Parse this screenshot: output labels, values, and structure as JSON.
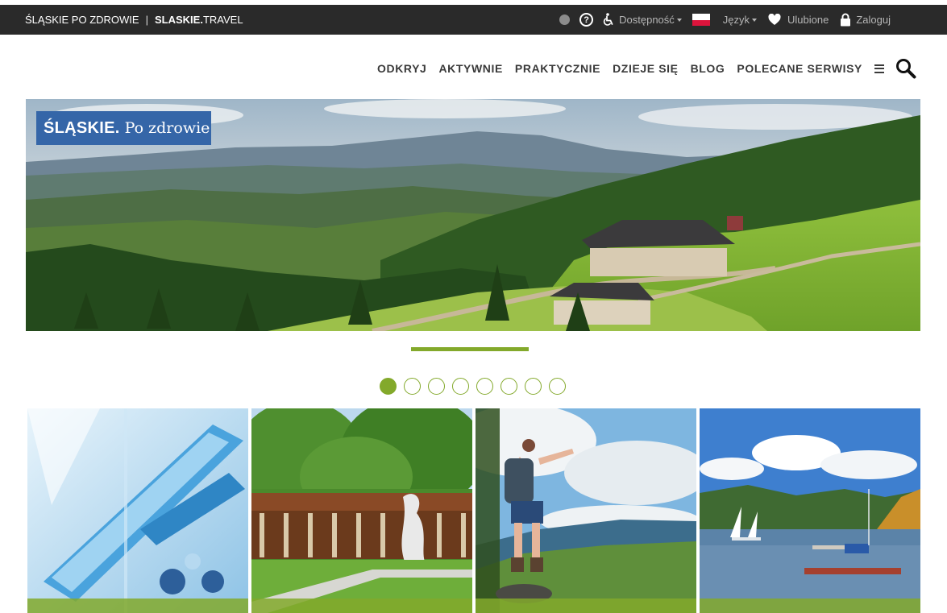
{
  "topbar": {
    "site_name": "ŚLĄSKIE PO ZDROWIE",
    "separator": "|",
    "travel_bold": "SLASKIE.",
    "travel_rest": "TRAVEL",
    "accessibility": "Dostępność",
    "language": "Język",
    "favorites": "Ulubione",
    "login": "Zaloguj",
    "help_glyph": "?"
  },
  "nav": {
    "items": [
      "ODKRYJ",
      "AKTYWNIE",
      "PRAKTYCZNIE",
      "DZIEJE SIĘ",
      "BLOG",
      "POLECANE SERWISY"
    ]
  },
  "hero": {
    "logo_bold": "ŚLĄSKIE.",
    "logo_script": "Po zdrowie"
  },
  "slider": {
    "count": 8,
    "active_index": 0
  },
  "tiles": [
    {
      "subject": "hospital-operating-lamp"
    },
    {
      "subject": "spa-pavilion-with-sculpture"
    },
    {
      "subject": "hiker-on-mountain"
    },
    {
      "subject": "sailboats-on-lake"
    }
  ],
  "colors": {
    "accent": "#83a92b",
    "topbar_bg": "#2a2a2a",
    "logo_bg": "#3566a8",
    "nav_text": "#3a3a3a"
  },
  "icons": [
    "contrast-icon",
    "help-icon",
    "wheelchair-icon",
    "poland-flag-icon",
    "heart-icon",
    "lock-icon",
    "hamburger-icon",
    "search-icon"
  ]
}
